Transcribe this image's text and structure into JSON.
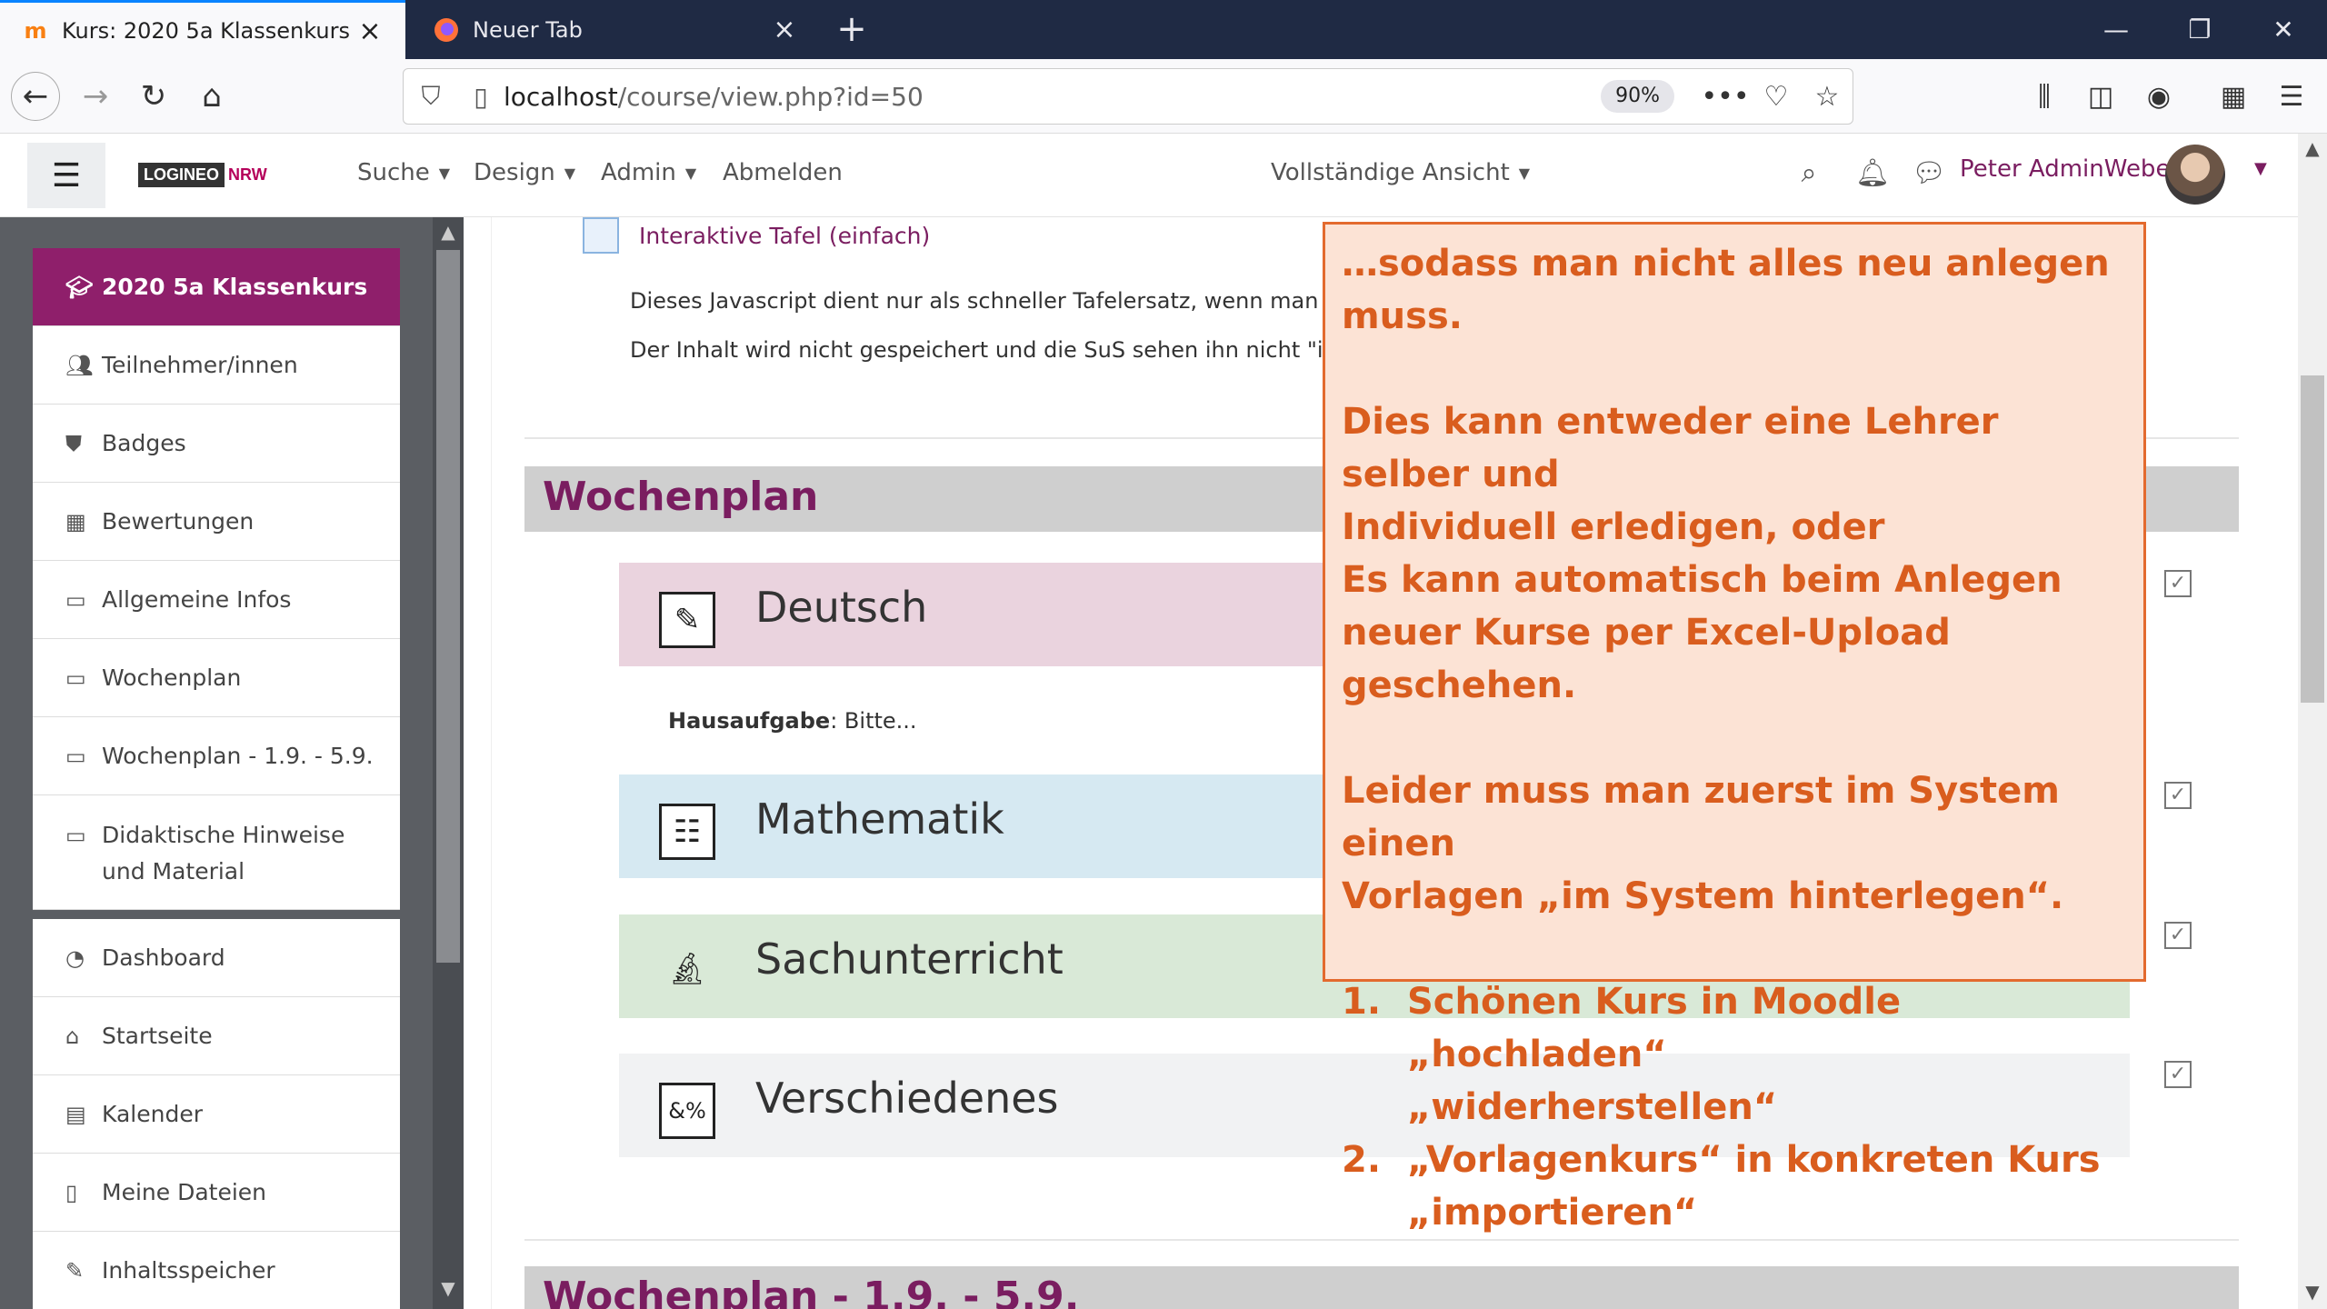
{
  "browser": {
    "tabs": [
      {
        "title": "Kurs: 2020 5a Klassenkurs",
        "active": true
      },
      {
        "title": "Neuer Tab",
        "active": false
      }
    ],
    "url_host": "localhost",
    "url_path": "/course/view.php?id=50",
    "zoom": "90%"
  },
  "header": {
    "logo_main": "LOGINEO",
    "logo_accent": "NRW",
    "menu": [
      "Suche",
      "Design",
      "Admin",
      "Abmelden"
    ],
    "view_mode": "Vollständige Ansicht",
    "user_name": "Peter AdminWeber"
  },
  "sidebar": {
    "course": "2020 5a Klassenkurs",
    "course_items": [
      "Teilnehmer/innen",
      "Badges",
      "Bewertungen",
      "Allgemeine Infos",
      "Wochenplan",
      "Wochenplan - 1.9. - 5.9."
    ],
    "tall_item": "Didaktische Hinweise und Material",
    "global_items": [
      "Dashboard",
      "Startseite",
      "Kalender",
      "Meine Dateien",
      "Inhaltsspeicher"
    ]
  },
  "main": {
    "activity_link": "Interaktive Tafel (einfach)",
    "desc_line1": "Dieses Javascript dient nur als schneller Tafelersatz, wenn man de",
    "desc_line2": "Der Inhalt wird nicht gespeichert und die SuS sehen ihn nicht \"in ih",
    "section1": "Wochenplan",
    "tiles": [
      "Deutsch",
      "Mathematik",
      "Sachunterricht",
      "Verschiedenes"
    ],
    "homework_label": "Hausaufgabe",
    "homework_text": ": Bitte...",
    "section2": "Wochenplan - 1.9. - 5.9."
  },
  "colors": {
    "brand": "#8f1f6b",
    "tile_deutsch": "#ead3de",
    "tile_mathematik": "#d6e9f2",
    "tile_sachunterricht": "#d9e9d7",
    "tile_verschiedenes": "#f1f2f3",
    "callout_bg": "#fce3d5",
    "callout_text": "#d95d1e"
  },
  "callout": {
    "line1": "…sodass man nicht alles neu anlegen muss.",
    "para2_l1": "Dies kann entweder eine Lehrer selber und",
    "para2_l2": "Individuell erledigen, oder",
    "para2_l3": "Es kann automatisch beim Anlegen",
    "para2_l4": "neuer Kurse per Excel-Upload geschehen.",
    "para3_l1": "Leider muss man zuerst im System einen",
    "para3_l2": "Vorlagen „im System hinterlegen“.",
    "step1_num": "1.",
    "step1_l1": "Schönen Kurs in Moodle „hochladen“",
    "step1_l2": "„widerherstellen“",
    "step2_num": "2.",
    "step2_l1": "„Vorlagenkurs“ in konkreten Kurs",
    "step2_l2": "„importieren“"
  }
}
